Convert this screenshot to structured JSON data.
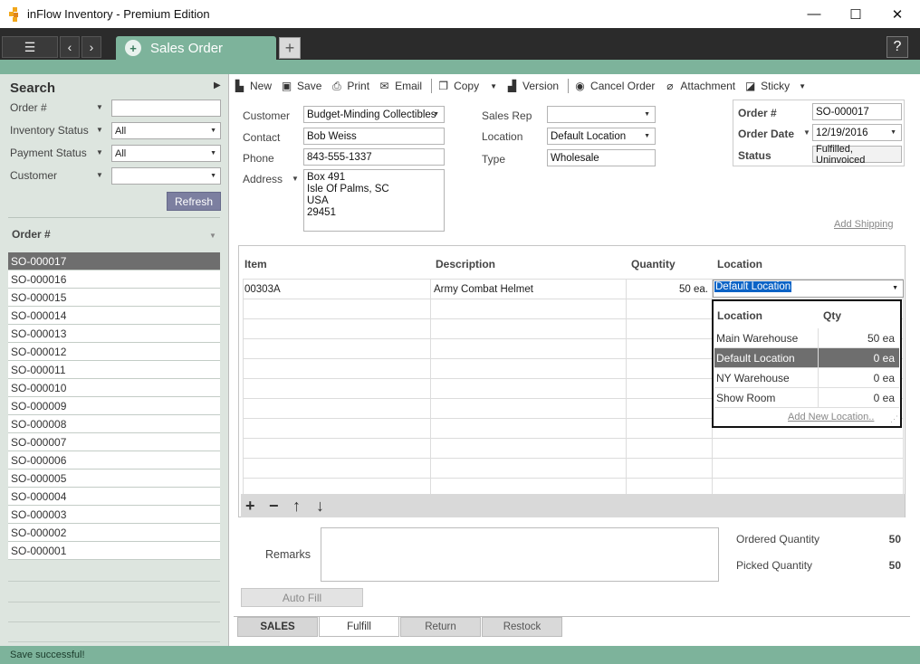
{
  "window": {
    "title": "inFlow Inventory - Premium Edition",
    "minimize": "—",
    "maximize": "☐",
    "close": "✕"
  },
  "topbar": {
    "menu_icon": "☰",
    "back_icon": "‹",
    "forward_icon": "›",
    "tab_label": "Sales Order",
    "add_tab": "+",
    "help": "?"
  },
  "sidebar": {
    "title": "Search",
    "filters": [
      {
        "label": "Order #",
        "value": ""
      },
      {
        "label": "Inventory Status",
        "value": "All"
      },
      {
        "label": "Payment Status",
        "value": "All"
      },
      {
        "label": "Customer",
        "value": ""
      }
    ],
    "refresh": "Refresh",
    "list_header": "Order #",
    "orders": [
      "SO-000017",
      "SO-000016",
      "SO-000015",
      "SO-000014",
      "SO-000013",
      "SO-000012",
      "SO-000011",
      "SO-000010",
      "SO-000009",
      "SO-000008",
      "SO-000007",
      "SO-000006",
      "SO-000005",
      "SO-000004",
      "SO-000003",
      "SO-000002",
      "SO-000001"
    ],
    "selected_order": "SO-000017"
  },
  "toolbar": {
    "new": "New",
    "save": "Save",
    "print": "Print",
    "email": "Email",
    "copy": "Copy",
    "version": "Version",
    "cancel": "Cancel Order",
    "attachment": "Attachment",
    "sticky": "Sticky"
  },
  "form": {
    "customer_label": "Customer",
    "customer": "Budget-Minding Collectibles",
    "contact_label": "Contact",
    "contact": "Bob Weiss",
    "phone_label": "Phone",
    "phone": "843-555-1337",
    "address_label": "Address",
    "address": [
      "Box 491",
      "Isle Of Palms, SC",
      "USA",
      "29451"
    ],
    "sales_rep_label": "Sales Rep",
    "sales_rep": "",
    "location_label": "Location",
    "location": "Default Location",
    "type_label": "Type",
    "type": "Wholesale",
    "order_no_label": "Order #",
    "order_no": "SO-000017",
    "order_date_label": "Order Date",
    "order_date": "12/19/2016",
    "status_label": "Status",
    "status": "Fulfilled, Uninvoiced",
    "add_shipping": "Add Shipping"
  },
  "grid": {
    "headers": {
      "item": "Item",
      "description": "Description",
      "quantity": "Quantity",
      "location": "Location"
    },
    "rows": [
      {
        "item": "00303A",
        "description": "Army Combat Helmet",
        "quantity": "50 ea.",
        "location": "Default Location"
      }
    ]
  },
  "location_popup": {
    "headers": {
      "location": "Location",
      "qty": "Qty"
    },
    "rows": [
      {
        "location": "Main Warehouse",
        "qty": "50 ea"
      },
      {
        "location": "Default Location",
        "qty": "0 ea"
      },
      {
        "location": "NY Warehouse",
        "qty": "0 ea"
      },
      {
        "location": "Show Room",
        "qty": "0 ea"
      }
    ],
    "selected": "Default Location",
    "add_new": "Add New Location.."
  },
  "bottom": {
    "remarks_label": "Remarks",
    "remarks": "",
    "ordered_qty_label": "Ordered Quantity",
    "ordered_qty": "50",
    "picked_qty_label": "Picked Quantity",
    "picked_qty": "50",
    "auto_fill": "Auto Fill"
  },
  "tabs": {
    "sales": "SALES",
    "fulfill": "Fulfill",
    "return": "Return",
    "restock": "Restock"
  },
  "status": "Save successful!"
}
